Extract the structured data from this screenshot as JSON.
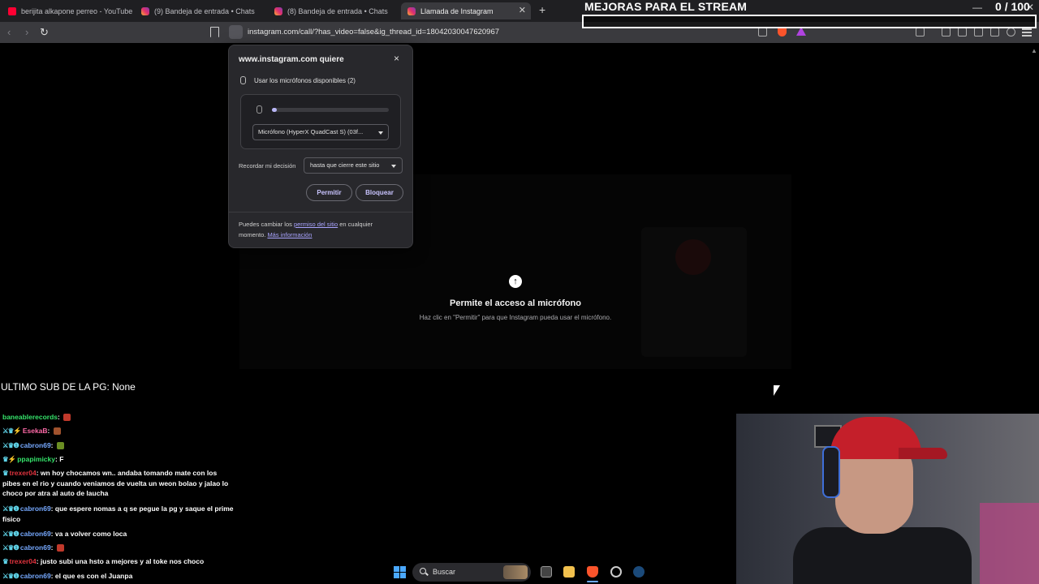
{
  "browser": {
    "tabs": [
      {
        "title": "berijita alkapone perreo - YouTube",
        "icon": "youtube-icon"
      },
      {
        "title": "(9) Bandeja de entrada • Chats",
        "icon": "instagram-icon"
      },
      {
        "title": "(8) Bandeja de entrada • Chats",
        "icon": "instagram-icon"
      },
      {
        "title": "Llamada de Instagram",
        "icon": "instagram-icon",
        "active": true
      }
    ],
    "new_tab": "+",
    "url": "instagram.com/call/?has_video=false&ig_thread_id=18042030047620967"
  },
  "stream_goal": {
    "title": "MEJORAS PARA EL STREAM",
    "current": "0",
    "total": "/ 100",
    "progress_fraction": 0.0
  },
  "permission_dialog": {
    "title": "www.instagram.com quiere",
    "close": "×",
    "mic_request": "Usar los micrófonos disponibles (2)",
    "mic_level_fraction": 0.04,
    "selected_device": "Micrófono (HyperX QuadCast S) (03f...",
    "remember_label": "Recordar mi decisión",
    "remember_value": "hasta que cierre este sitio",
    "allow_label": "Permitir",
    "block_label": "Bloquear",
    "footer_text_1": "Puedes cambiar los ",
    "footer_link_1": "permiso del sitio",
    "footer_text_2": " en cualquier momento. ",
    "footer_link_2": "Más información"
  },
  "page": {
    "heading": "Permite el acceso al micrófono",
    "hint": "Haz clic en \"Permitir\" para que Instagram pueda usar el micrófono."
  },
  "overlay": {
    "last_sub": "ULTIMO SUB DE LA PG: None"
  },
  "chat": [
    {
      "badges": "",
      "user": "baneablerecords",
      "color": "u-green",
      "message": "",
      "emote": "#c0392b"
    },
    {
      "badges": "⚔♛⚡",
      "user": "EsekaB",
      "color": "u-pink",
      "message": "",
      "emote": "#a0522d"
    },
    {
      "badges": "⚔♛❶",
      "user": "cabron69",
      "color": "u-blue",
      "message": "",
      "emote": "#6b8e23"
    },
    {
      "badges": "♛⚡",
      "user": "ppapimicky",
      "color": "u-green",
      "message": "F",
      "emote": ""
    },
    {
      "badges": "♛",
      "user": "trexer04",
      "color": "u-red",
      "message": "wn hoy chocamos wn.. andaba tomando mate con los pibes en el rio y cuando veniamos de vuelta un weon bolao y jalao lo choco por atra al auto de laucha",
      "emote": ""
    },
    {
      "badges": "⚔♛❶",
      "user": "cabron69",
      "color": "u-blue",
      "message": "que espere nomas a q se pegue la pg y saque el prime fisico",
      "emote": ""
    },
    {
      "badges": "⚔♛❶",
      "user": "cabron69",
      "color": "u-blue",
      "message": "va a volver como loca",
      "emote": ""
    },
    {
      "badges": "⚔♛❶",
      "user": "cabron69",
      "color": "u-blue",
      "message": "",
      "emote": "#c0392b"
    },
    {
      "badges": "♛",
      "user": "trexer04",
      "color": "u-red",
      "message": "justo subi una hsto a mejores y al toke nos choco",
      "emote": ""
    },
    {
      "badges": "⚔♛❶",
      "user": "cabron69",
      "color": "u-blue",
      "message": "el que es con el Juanpa",
      "emote": ""
    }
  ],
  "taskbar": {
    "search_label": "Buscar"
  }
}
